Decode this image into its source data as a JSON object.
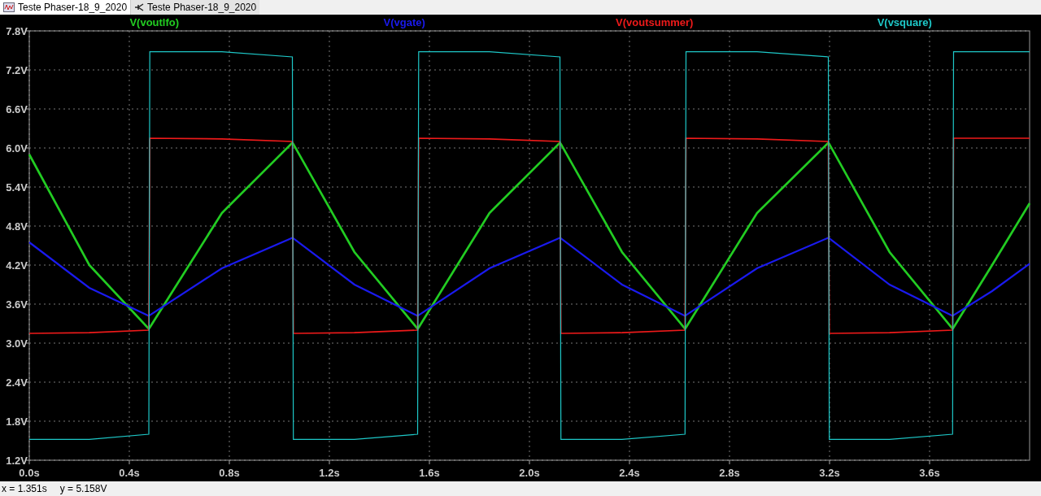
{
  "tabs": [
    {
      "label": "Teste Phaser-18_9_2020",
      "kind": "waveform",
      "selected": true
    },
    {
      "label": "Teste Phaser-18_9_2020",
      "kind": "schematic",
      "selected": false
    }
  ],
  "plot": {
    "chart_data": {
      "type": "line",
      "grid": true,
      "x": [
        0,
        0.24,
        0.478,
        0.482,
        0.77,
        1.052,
        1.056,
        1.3,
        1.553,
        1.557,
        1.84,
        2.122,
        2.126,
        2.37,
        2.622,
        2.626,
        2.91,
        3.195,
        3.199,
        3.44,
        3.692,
        3.696,
        3.85,
        4.0
      ],
      "series": [
        {
          "name": "V(voutlfo)",
          "color": "#22cc22",
          "values": [
            5.9,
            4.2,
            3.22,
            3.24,
            5.0,
            6.08,
            6.06,
            4.4,
            3.22,
            3.24,
            5.0,
            6.08,
            6.06,
            4.4,
            3.22,
            3.24,
            5.0,
            6.08,
            6.06,
            4.4,
            3.22,
            3.24,
            4.2,
            5.15
          ]
        },
        {
          "name": "V(vgate)",
          "color": "#1a1aee",
          "values": [
            4.55,
            3.85,
            3.42,
            3.43,
            4.15,
            4.62,
            4.61,
            3.9,
            3.42,
            3.43,
            4.15,
            4.62,
            4.61,
            3.9,
            3.42,
            3.43,
            4.15,
            4.62,
            4.61,
            3.9,
            3.42,
            3.43,
            3.8,
            4.22
          ]
        },
        {
          "name": "V(voutsummer)",
          "color": "#ee1a1a",
          "values": [
            3.15,
            3.16,
            3.2,
            6.15,
            6.14,
            6.1,
            3.15,
            3.16,
            3.2,
            6.15,
            6.14,
            6.1,
            3.15,
            3.16,
            3.2,
            6.15,
            6.14,
            6.1,
            3.15,
            3.16,
            3.2,
            6.15,
            6.15,
            6.15
          ]
        },
        {
          "name": "V(vsquare)",
          "color": "#1ec8c8",
          "values": [
            1.52,
            1.52,
            1.6,
            7.48,
            7.48,
            7.4,
            1.52,
            1.52,
            1.6,
            7.48,
            7.48,
            7.4,
            1.52,
            1.52,
            1.6,
            7.48,
            7.48,
            7.4,
            1.52,
            1.52,
            1.6,
            7.48,
            7.48,
            7.48
          ]
        }
      ],
      "xlim": [
        0,
        4
      ],
      "ylim": [
        1.2,
        7.8
      ],
      "xticks": [
        {
          "value": 0,
          "label": "0.0s"
        },
        {
          "value": 0.4,
          "label": "0.4s"
        },
        {
          "value": 0.8,
          "label": "0.8s"
        },
        {
          "value": 1.2,
          "label": "1.2s"
        },
        {
          "value": 1.6,
          "label": "1.6s"
        },
        {
          "value": 2.0,
          "label": "2.0s"
        },
        {
          "value": 2.4,
          "label": "2.4s"
        },
        {
          "value": 2.8,
          "label": "2.8s"
        },
        {
          "value": 3.2,
          "label": "3.2s"
        },
        {
          "value": 3.6,
          "label": "3.6s"
        }
      ],
      "yticks": [
        {
          "value": 1.2,
          "label": "1.2V"
        },
        {
          "value": 1.8,
          "label": "1.8V"
        },
        {
          "value": 2.4,
          "label": "2.4V"
        },
        {
          "value": 3.0,
          "label": "3.0V"
        },
        {
          "value": 3.6,
          "label": "3.6V"
        },
        {
          "value": 4.2,
          "label": "4.2V"
        },
        {
          "value": 4.8,
          "label": "4.8V"
        },
        {
          "value": 5.4,
          "label": "5.4V"
        },
        {
          "value": 6.0,
          "label": "6.0V"
        },
        {
          "value": 6.6,
          "label": "6.6V"
        },
        {
          "value": 7.2,
          "label": "7.2V"
        },
        {
          "value": 7.8,
          "label": "7.8V"
        }
      ]
    }
  },
  "status_bar": {
    "x_reading": "x = 1.351s",
    "y_reading": "y = 5.158V"
  }
}
